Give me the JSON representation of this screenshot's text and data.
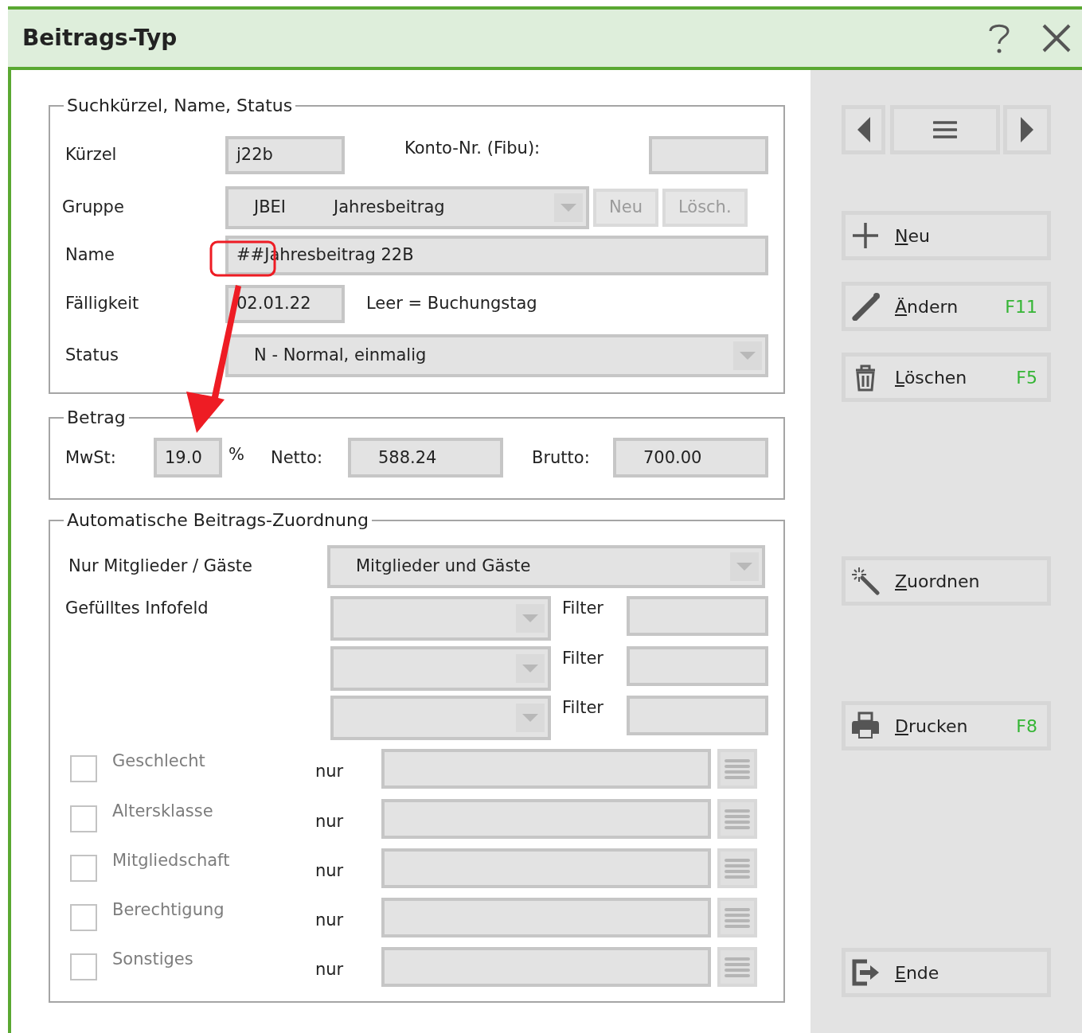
{
  "window": {
    "title": "Beitrags-Typ"
  },
  "search_group": {
    "legend": "Suchkürzel, Name, Status",
    "kuerzel": {
      "label": "Kürzel",
      "value": "j22b"
    },
    "konto": {
      "label": "Konto-Nr. (Fibu):"
    },
    "gruppe": {
      "label": "Gruppe",
      "code": "JBEI",
      "text": "Jahresbeitrag",
      "buttons": [
        {
          "label": "Neu",
          "disabled": true
        },
        {
          "label": "Lösch.",
          "disabled": true
        }
      ]
    },
    "name": {
      "label": "Name",
      "value": "##Jahresbeitrag 22B"
    },
    "faelligkeit": {
      "label": "Fälligkeit",
      "value": "02.01.22",
      "hint": "Leer = Buchungstag"
    },
    "status": {
      "label": "Status",
      "value": "N - Normal, einmalig"
    }
  },
  "annotation": {
    "kind": "highlight-arrow"
  },
  "amount_group": {
    "legend": "Betrag",
    "mwst": {
      "label": "MwSt:",
      "value": "19.0",
      "unit": "%"
    },
    "netto": {
      "label": "Netto:",
      "value": "588.24"
    },
    "brutto": {
      "label": "Brutto:",
      "value": "700.00"
    }
  },
  "auto_group": {
    "legend": "Automatische Beitrags-Zuordnung",
    "members": {
      "label": "Nur Mitglieder / Gäste",
      "value": "Mitglieder und Gäste"
    },
    "infofield": {
      "label": "Gefülltes Infofeld",
      "filters": [
        {
          "label": "Filter"
        },
        {
          "label": "Filter"
        },
        {
          "label": "Filter"
        }
      ]
    },
    "criteria": [
      {
        "label": "Geschlecht",
        "checked": false,
        "disabled": true,
        "only": "nur"
      },
      {
        "label": "Altersklasse",
        "checked": false,
        "disabled": true,
        "only": "nur"
      },
      {
        "label": "Mitgliedschaft",
        "checked": false,
        "disabled": true,
        "only": "nur"
      },
      {
        "label": "Berechtigung",
        "checked": false,
        "disabled": true,
        "only": "nur"
      },
      {
        "label": "Sonstiges",
        "checked": false,
        "disabled": true,
        "only": "nur"
      }
    ]
  },
  "actions": [
    {
      "kind": "new",
      "label": "Neu"
    },
    {
      "kind": "edit",
      "label": "Ändern",
      "shortcut": "F11"
    },
    {
      "kind": "delete",
      "label": "Löschen",
      "shortcut": "F5"
    },
    {
      "kind": "assign",
      "label": "Zuordnen"
    },
    {
      "kind": "print",
      "label": "Drucken",
      "shortcut": "F8"
    },
    {
      "kind": "exit",
      "label": "Ende"
    }
  ]
}
